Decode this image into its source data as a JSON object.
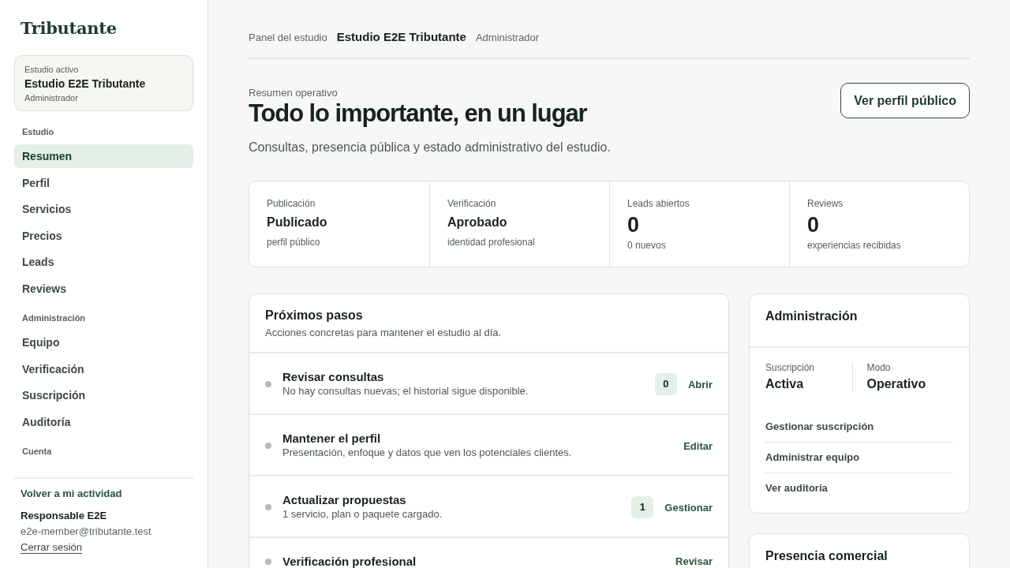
{
  "sidebar": {
    "logo": "Tributante",
    "studio_card": {
      "label": "Estudio activo",
      "name": "Estudio E2E Tributante",
      "role": "Administrador"
    },
    "sections": [
      {
        "heading": "Estudio",
        "items": [
          {
            "label": "Resumen",
            "selected": true
          },
          {
            "label": "Perfil",
            "selected": false
          },
          {
            "label": "Servicios",
            "selected": false
          },
          {
            "label": "Precios",
            "selected": false
          },
          {
            "label": "Leads",
            "selected": false
          },
          {
            "label": "Reviews",
            "selected": false
          }
        ]
      },
      {
        "heading": "Administración",
        "items": [
          {
            "label": "Equipo",
            "selected": false
          },
          {
            "label": "Verificación",
            "selected": false
          },
          {
            "label": "Suscripción",
            "selected": false
          },
          {
            "label": "Auditoría",
            "selected": false
          }
        ]
      },
      {
        "heading": "Cuenta"
      }
    ],
    "account": {
      "back_link": "Volver a mi actividad",
      "user_name": "Responsable E2E",
      "email": "e2e-member@tributante.test",
      "logout": "Cerrar sesión"
    }
  },
  "topbar": {
    "context": "Panel del estudio",
    "studio": "Estudio E2E Tributante",
    "role": "Administrador"
  },
  "hero": {
    "eyebrow": "Resumen operativo",
    "title": "Todo lo importante, en un lugar",
    "subtitle": "Consultas, presencia pública y estado administrativo del estudio.",
    "button": "Ver perfil público"
  },
  "stats": [
    {
      "kind": "text",
      "label": "Publicación",
      "value": "Publicado",
      "note": "perfil público"
    },
    {
      "kind": "text",
      "label": "Verificación",
      "value": "Aprobado",
      "note": "identidad profesional"
    },
    {
      "kind": "number",
      "label": "Leads abiertos",
      "value": "0",
      "note": "0 nuevos"
    },
    {
      "kind": "number",
      "label": "Reviews",
      "value": "0",
      "note": "experiencias recibidas"
    }
  ],
  "next_steps": {
    "title": "Próximos pasos",
    "subtitle": "Acciones concretas para mantener el estudio al día.",
    "rows": [
      {
        "title": "Revisar consultas",
        "description": "No hay consultas nuevas; el historial sigue disponible.",
        "count": "0",
        "action": "Abrir"
      },
      {
        "title": "Mantener el perfil",
        "description": "Presentación, enfoque y datos que ven los potenciales clientes.",
        "action": "Editar"
      },
      {
        "title": "Actualizar propuestas",
        "description": "1 servicio, plan o paquete cargado.",
        "count": "1",
        "action": "Gestionar"
      },
      {
        "title": "Verificación profesional",
        "action": "Revisar"
      }
    ]
  },
  "administration": {
    "title": "Administración",
    "facts": [
      {
        "label": "Suscripción",
        "value": "Activa"
      },
      {
        "label": "Modo",
        "value": "Operativo"
      }
    ],
    "links": [
      "Gestionar suscripción",
      "Administrar equipo",
      "Ver auditoría"
    ]
  },
  "commercial_presence": {
    "title": "Presencia comercial"
  }
}
